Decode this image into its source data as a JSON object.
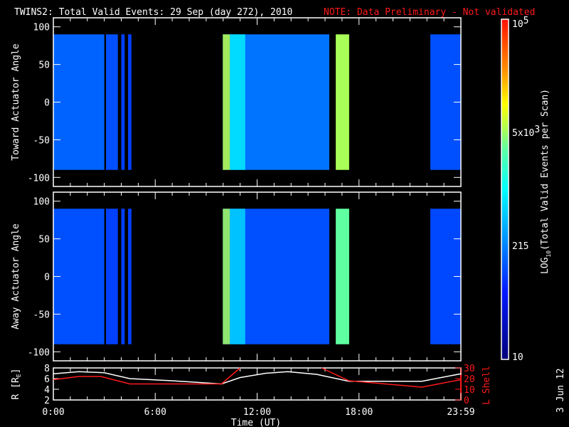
{
  "title": "TWINS2: Total Valid Events: 29 Sep (day 272), 2010",
  "note": "NOTE: Data Preliminary - Not validated",
  "stamp": "3 Jun 12",
  "chart_data": [
    {
      "type": "heatmap",
      "ylabel": "Toward Actuator Angle",
      "ylim": [
        -112,
        112
      ],
      "yticks": [
        "100",
        "50",
        "0",
        "-50",
        "-100"
      ],
      "ytick_values": [
        100,
        50,
        0,
        -50,
        -100
      ],
      "segments": [
        {
          "x": [
            0,
            3.0
          ],
          "level": 150
        },
        {
          "x": [
            3.1,
            3.8
          ],
          "level": 120
        },
        {
          "x": [
            4.0,
            4.2
          ],
          "level": 100
        },
        {
          "x": [
            4.4,
            4.6
          ],
          "level": 100
        },
        {
          "x": [
            9.98,
            16.25
          ],
          "level": 180
        },
        {
          "x": [
            16.63,
            17.42
          ],
          "level": 5000
        },
        {
          "x": [
            22.2,
            24
          ],
          "level": 120
        }
      ],
      "bright_bands": [
        {
          "x": [
            9.98,
            10.4
          ],
          "level": 6000
        },
        {
          "x": [
            10.4,
            11.3
          ],
          "level": 800
        }
      ]
    },
    {
      "type": "heatmap",
      "ylabel": "Away Actuator Angle",
      "ylim": [
        -112,
        112
      ],
      "yticks": [
        "100",
        "50",
        "0",
        "-50",
        "-100"
      ],
      "ytick_values": [
        100,
        50,
        0,
        -50,
        -100
      ],
      "segments": [
        {
          "x": [
            0,
            3.0
          ],
          "level": 120
        },
        {
          "x": [
            3.1,
            3.8
          ],
          "level": 100
        },
        {
          "x": [
            4.0,
            4.2
          ],
          "level": 100
        },
        {
          "x": [
            4.4,
            4.6
          ],
          "level": 100
        },
        {
          "x": [
            9.98,
            16.25
          ],
          "level": 120
        },
        {
          "x": [
            16.63,
            17.42
          ],
          "level": 3000
        },
        {
          "x": [
            22.2,
            24
          ],
          "level": 110
        }
      ],
      "bright_bands": [
        {
          "x": [
            9.98,
            10.4
          ],
          "level": 5000
        },
        {
          "x": [
            10.4,
            11.3
          ],
          "level": 600
        }
      ]
    },
    {
      "type": "line",
      "ylabel": "R [R",
      "ylabel_sub": "E",
      "ylabel_close": "]",
      "y2label": "L Shell",
      "ylim": [
        2,
        8
      ],
      "y2lim": [
        0,
        30
      ],
      "yticks": [
        "8",
        "6",
        "4",
        "2"
      ],
      "ytick_values": [
        8,
        6,
        4,
        2
      ],
      "y2ticks": [
        "30",
        "20",
        "10",
        "0"
      ],
      "y2tick_values": [
        30,
        20,
        10,
        0
      ],
      "xlabel": "Time (UT)",
      "xticks": [
        "0:00",
        "6:00",
        "12:00",
        "18:00",
        "23:59"
      ],
      "xtick_values": [
        0,
        6,
        12,
        18,
        24
      ],
      "xlim": [
        0,
        24
      ],
      "series": [
        {
          "name": "R",
          "color": "#ffffff",
          "axis": "left",
          "x": [
            0,
            1.5,
            3,
            4.5,
            7,
            9.9,
            11,
            12.5,
            13.8,
            15.5,
            17.4,
            21.7,
            23,
            24
          ],
          "y": [
            6.9,
            7.3,
            7.1,
            6.0,
            5.6,
            5.0,
            6.2,
            7.0,
            7.3,
            6.8,
            5.5,
            5.5,
            6.3,
            6.9
          ]
        },
        {
          "name": "L Shell",
          "color": "#ff1a1a",
          "axis": "right",
          "x": [
            0,
            1.5,
            2.8,
            4.5,
            9.9,
            11.0
          ],
          "y": [
            19,
            22,
            22,
            15,
            15,
            30
          ]
        },
        {
          "name": "L Shell (2)",
          "color": "#ff1a1a",
          "axis": "right",
          "x": [
            15.8,
            17.4,
            21.7,
            24
          ],
          "y": [
            30,
            18,
            12,
            19
          ]
        }
      ]
    },
    {
      "type": "colorbar",
      "label": "LOG",
      "label_sub": "10",
      "label_rest": "(Total Valid Events per Scan)",
      "ticks": [
        "10",
        "215",
        "5x10",
        "10"
      ],
      "tick_sup": [
        "",
        "",
        "3",
        "5"
      ],
      "range": [
        10,
        100000
      ]
    }
  ]
}
